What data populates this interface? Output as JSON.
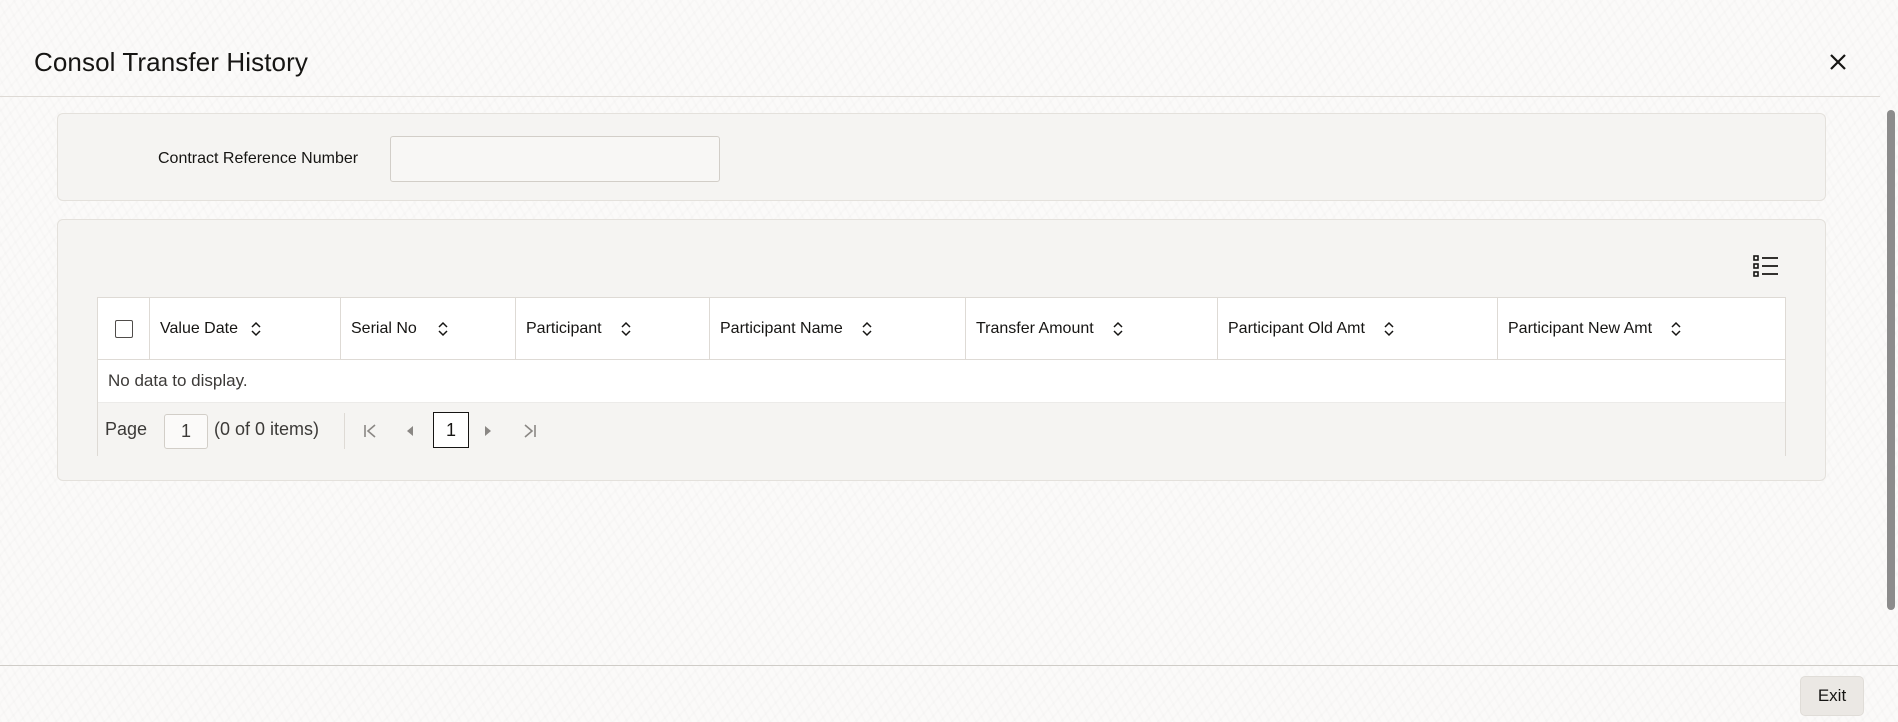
{
  "window": {
    "title": "Consol Transfer History",
    "close_icon": "close-icon"
  },
  "form": {
    "contract_reference_label": "Contract Reference Number",
    "contract_reference_value": ""
  },
  "grid": {
    "columns_menu_icon": "list-columns-icon",
    "columns": [
      "Value Date",
      "Serial No",
      "Participant",
      "Participant Name",
      "Transfer Amount",
      "Participant Old Amt",
      "Participant New Amt"
    ],
    "rows": [],
    "empty_text": "No data to display."
  },
  "pagination": {
    "page_label": "Page",
    "page_value": "1",
    "count_text": "(0 of 0 items)",
    "current_page": "1"
  },
  "footer": {
    "exit_label": "Exit"
  },
  "colors": {
    "text": "#161513",
    "border": "#dedad5",
    "panel": "#f5f4f2"
  }
}
